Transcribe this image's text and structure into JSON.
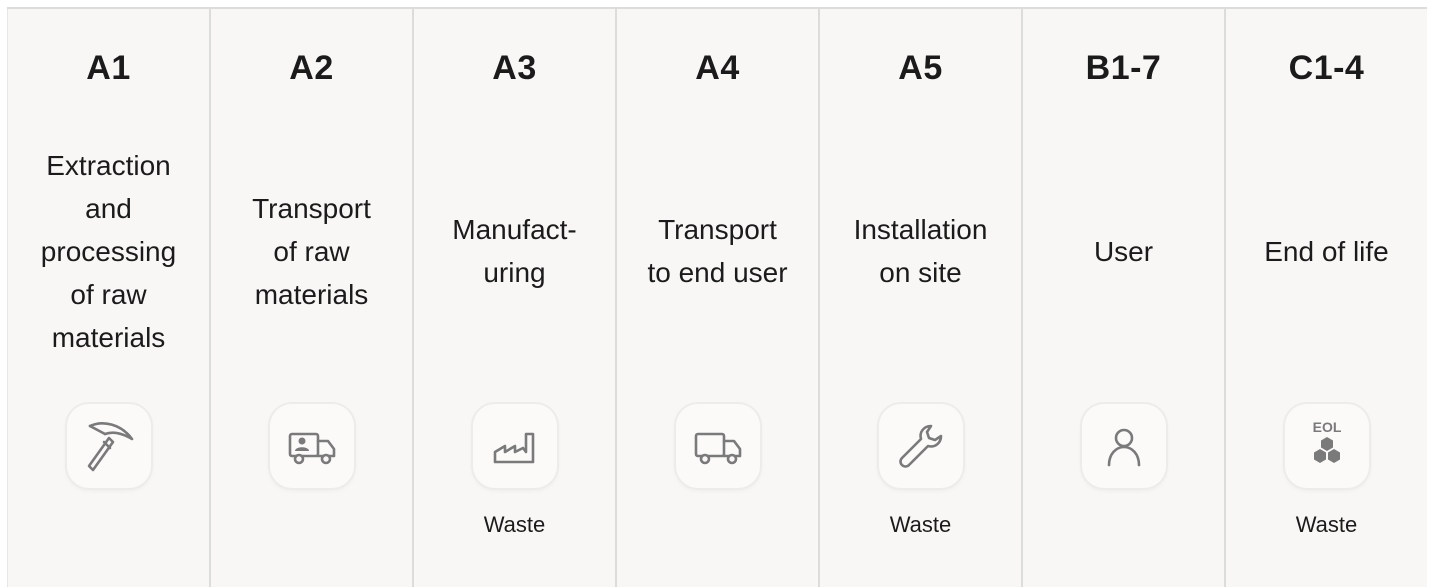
{
  "stages": [
    {
      "code": "A1",
      "description": "Extraction\nand\nprocessing\nof raw\nmaterials",
      "lines": 5,
      "icon": "pickaxe-icon",
      "waste": ""
    },
    {
      "code": "A2",
      "description": "Transport\nof raw\nmaterials",
      "lines": 3,
      "icon": "truck-with-person-icon",
      "waste": ""
    },
    {
      "code": "A3",
      "description": "Manufact-\nuring",
      "lines": 2,
      "icon": "factory-icon",
      "waste": "Waste"
    },
    {
      "code": "A4",
      "description": "Transport\nto end user",
      "lines": 2,
      "icon": "truck-icon",
      "waste": ""
    },
    {
      "code": "A5",
      "description": "Installation\non site",
      "lines": 2,
      "icon": "wrench-icon",
      "waste": "Waste"
    },
    {
      "code": "B1-7",
      "description": "User",
      "lines": 1,
      "icon": "user-icon",
      "waste": ""
    },
    {
      "code": "C1-4",
      "description": "End of life",
      "lines": 1,
      "icon": "eol-hexagons-icon",
      "icon_text": "EOL",
      "waste": "Waste"
    }
  ],
  "colors": {
    "background": "#f8f7f5",
    "divider": "#dcdcda",
    "text": "#1b1b1b",
    "icon": "#7a7a7a"
  }
}
